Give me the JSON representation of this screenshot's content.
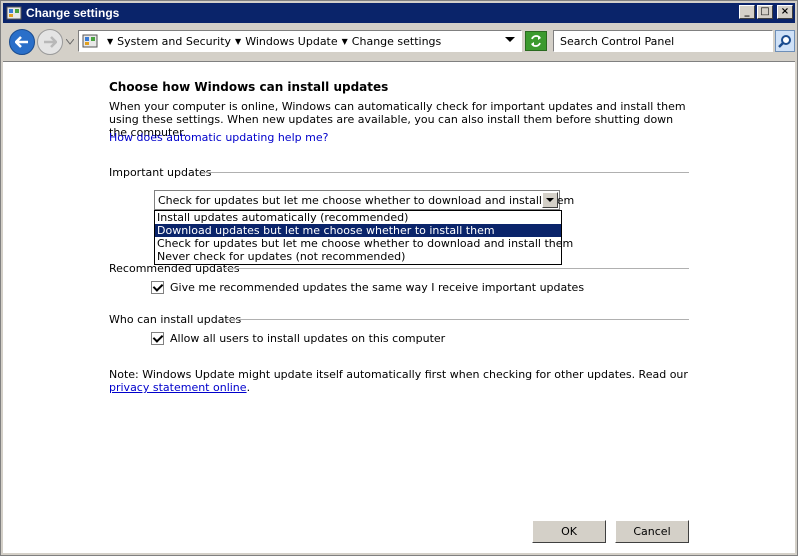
{
  "window": {
    "title": "Change settings",
    "controls": [
      "minimize",
      "maximize",
      "close"
    ]
  },
  "nav": {
    "breadcrumb": [
      "System and Security",
      "Windows Update",
      "Change settings"
    ],
    "search_placeholder": "Search Control Panel"
  },
  "page": {
    "heading": "Choose how Windows can install updates",
    "description": "When your computer is online, Windows can automatically check for important updates and install them using these settings. When new updates are available, you can also install them before shutting down the computer.",
    "help_link": "How does automatic updating help me?",
    "important": {
      "label": "Important updates",
      "selected": "Check for updates but let me choose whether to download and install them",
      "options": [
        "Install updates automatically (recommended)",
        "Download updates but let me choose whether to install them",
        "Check for updates but let me choose whether to download and install them",
        "Never check for updates (not recommended)"
      ],
      "highlighted_index": 1
    },
    "recommended": {
      "label": "Recommended updates",
      "checkbox_label": "Give me recommended updates the same way I receive important updates",
      "checked": true
    },
    "who": {
      "label": "Who can install updates",
      "checkbox_label": "Allow all users to install updates on this computer",
      "checked": true
    },
    "note_text": "Note: Windows Update might update itself automatically first when checking for other updates.  Read our ",
    "note_link": "privacy statement online",
    "note_end": "."
  },
  "buttons": {
    "ok": "OK",
    "cancel": "Cancel"
  }
}
